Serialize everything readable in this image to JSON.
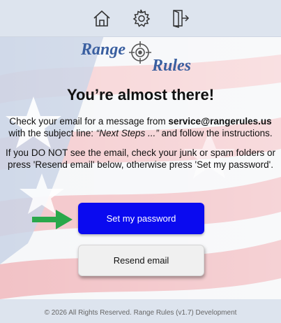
{
  "nav": {
    "items": [
      {
        "icon": "home-icon"
      },
      {
        "icon": "gear-icon"
      },
      {
        "icon": "logout-icon"
      }
    ]
  },
  "logo": {
    "word1": "Range",
    "word2": "Rules"
  },
  "heading": "You’re almost there!",
  "message1": {
    "part1": "Check your email for a message from ",
    "email": "service@rangerules.us",
    "part2": " with the subject line: ",
    "subject": "“Next Steps ...”",
    "part3": " and follow the instructions."
  },
  "message2": "If you DO NOT see the email, check your junk or spam folders or press 'Resend email' below, otherwise press 'Set my password'.",
  "buttons": {
    "set_password": "Set my password",
    "resend_email": "Resend email"
  },
  "footer": {
    "text": "© 2026 All Rights Reserved. Range Rules (v1.7) Development"
  },
  "colors": {
    "primary_button": "#0a0af0",
    "arrow": "#2aa84a",
    "logo": "#3a5fa0"
  }
}
